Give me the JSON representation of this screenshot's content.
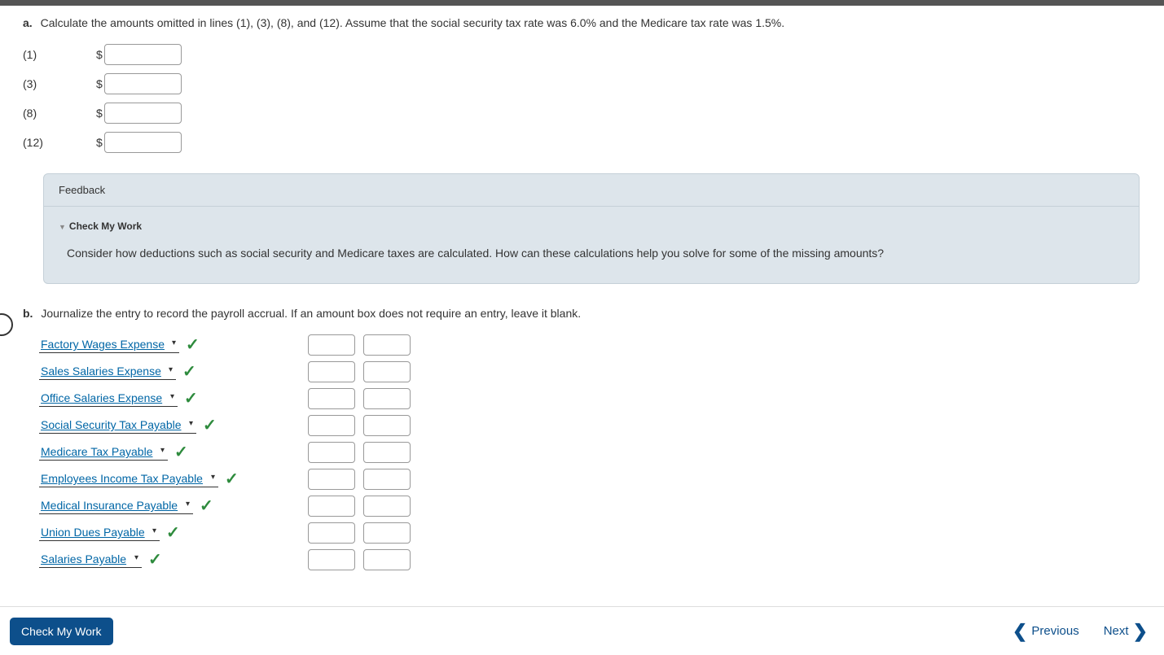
{
  "section_a": {
    "prefix": "a.",
    "question": "Calculate the amounts omitted in lines (1), (3), (8), and (12). Assume that the social security tax rate was 6.0% and the Medicare tax rate was 1.5%.",
    "inputs": [
      {
        "label": "(1)",
        "prefix": "$",
        "value": ""
      },
      {
        "label": "(3)",
        "prefix": "$",
        "value": ""
      },
      {
        "label": "(8)",
        "prefix": "$",
        "value": ""
      },
      {
        "label": "(12)",
        "prefix": "$",
        "value": ""
      }
    ]
  },
  "feedback": {
    "title": "Feedback",
    "toggle_label": "Check My Work",
    "hint": "Consider how deductions such as social security and Medicare taxes are calculated. How can these calculations help you solve for some of the missing amounts?"
  },
  "section_b": {
    "prefix": "b.",
    "question": "Journalize the entry to record the payroll accrual. If an amount box does not require an entry, leave it blank.",
    "rows": [
      {
        "account": "Factory Wages Expense",
        "correct": true
      },
      {
        "account": "Sales Salaries Expense",
        "correct": true
      },
      {
        "account": "Office Salaries Expense",
        "correct": true
      },
      {
        "account": "Social Security Tax Payable",
        "correct": true
      },
      {
        "account": "Medicare Tax Payable",
        "correct": true
      },
      {
        "account": "Employees Income Tax Payable",
        "correct": true
      },
      {
        "account": "Medical Insurance Payable",
        "correct": true
      },
      {
        "account": "Union Dues Payable",
        "correct": true
      },
      {
        "account": "Salaries Payable",
        "correct": true
      }
    ]
  },
  "footer": {
    "check_button": "Check My Work",
    "previous": "Previous",
    "next": "Next"
  }
}
